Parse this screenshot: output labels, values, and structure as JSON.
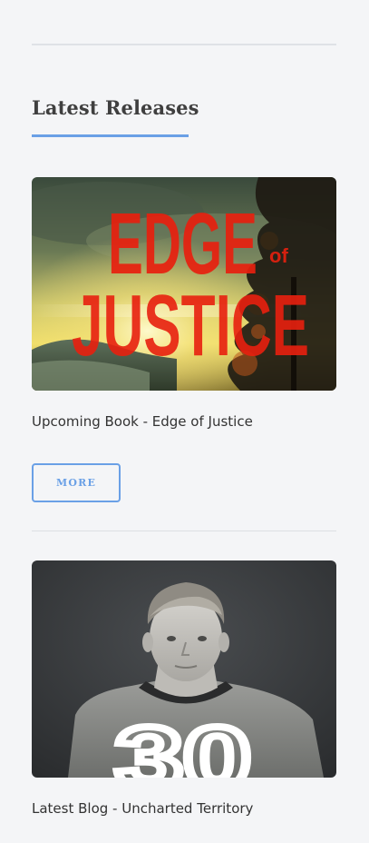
{
  "section": {
    "title": "Latest Releases"
  },
  "cards": [
    {
      "image_title_line1": "EDGE",
      "image_title_of": "of",
      "image_title_line2": "JUSTICE",
      "caption": "Upcoming Book - Edge of Justice",
      "button_label": "MORE"
    },
    {
      "caption": "Latest Blog - Uncharted Territory",
      "jersey_number": "30"
    }
  ],
  "colors": {
    "accent": "#6aa0e6",
    "background": "#f4f5f7",
    "divider": "#dfe2e6",
    "cover_red": "#e8200f"
  }
}
